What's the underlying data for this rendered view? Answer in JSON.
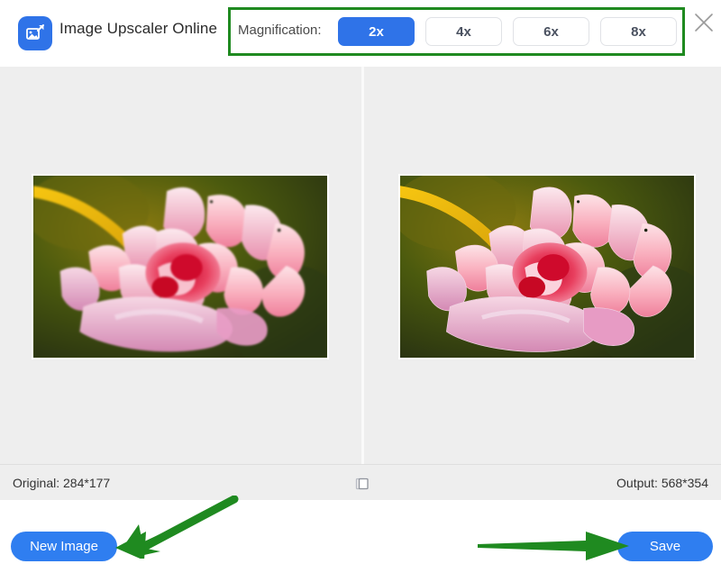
{
  "header": {
    "logo_icon": "image-upscale-icon",
    "title": "Image Upscaler Online",
    "magnification_label": "Magnification:",
    "magnification_options": [
      {
        "label": "2x",
        "selected": true
      },
      {
        "label": "4x",
        "selected": false
      },
      {
        "label": "6x",
        "selected": false
      },
      {
        "label": "8x",
        "selected": false
      }
    ],
    "close_icon": "close-icon"
  },
  "compare": {
    "original_panel": {
      "name": "original-image",
      "alt": "pink dahlia flower with yellow stem on dark green background, blurry"
    },
    "output_panel": {
      "name": "upscaled-image",
      "alt": "pink dahlia flower with yellow stem on dark green background, sharpened"
    },
    "divider_icon": "compare-slider-divider"
  },
  "info_bar": {
    "original_size": "Original: 284*177",
    "output_size": "Output: 568*354",
    "compare_handle_icon": "compare-toggle-icon"
  },
  "footer": {
    "new_image_label": "New Image",
    "save_label": "Save"
  },
  "annotations": {
    "highlight_box": "magnification-highlight",
    "arrow_new_image": "arrow-pointing-to-new-image",
    "arrow_save": "arrow-pointing-to-save"
  },
  "colors": {
    "accent_blue": "#2f73e8",
    "button_blue": "#2f7ef0",
    "annotation_green": "#1f8a20",
    "canvas_gray": "#eeeeee"
  }
}
